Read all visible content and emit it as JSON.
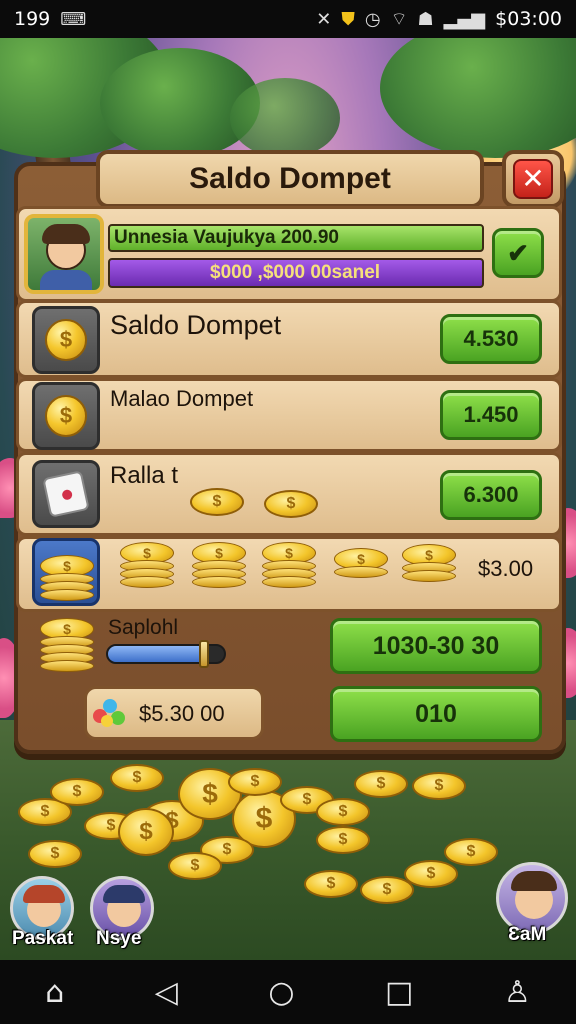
{
  "status_bar": {
    "notification_count": "199",
    "time": "$03:00",
    "icons": [
      "keyboard-icon",
      "mute-icon",
      "shield-icon",
      "alarm-icon",
      "wifi-icon",
      "robot-icon",
      "signal-icon"
    ]
  },
  "dialog": {
    "title": "Saldo Dompet",
    "close_icon": "close-icon"
  },
  "player": {
    "name_level": "Unnesia Vaujukya 200.90",
    "balance_bar": "$000 ,$000 00sanel",
    "confirm_icon": "check-icon"
  },
  "rows": [
    {
      "label": "Saldo Dompet",
      "value": "4.530",
      "icon": "coin-icon"
    },
    {
      "label": "Malao Dompet",
      "value": "1.450",
      "icon": "coin-icon"
    },
    {
      "label": "Ralla t",
      "value": "6.300",
      "icon": "dice-icon"
    }
  ],
  "coin_stacks_value": "$3.00",
  "slider": {
    "label": "Saplohl",
    "button_value": "1030-30 30",
    "fill_level": 0.82
  },
  "gem_total": "$5.30 00",
  "gem_button": "010",
  "avatars": [
    {
      "name": "Paskat"
    },
    {
      "name": "Nsye"
    },
    {
      "name": "ƐaM"
    }
  ],
  "colors": {
    "wood": "#7a4e2c",
    "parchment": "#f2d9b2",
    "green_button": "#6cc132",
    "close_red": "#e0352b",
    "gold": "#f3c52a",
    "purple_bar": "#8b3fd1"
  }
}
